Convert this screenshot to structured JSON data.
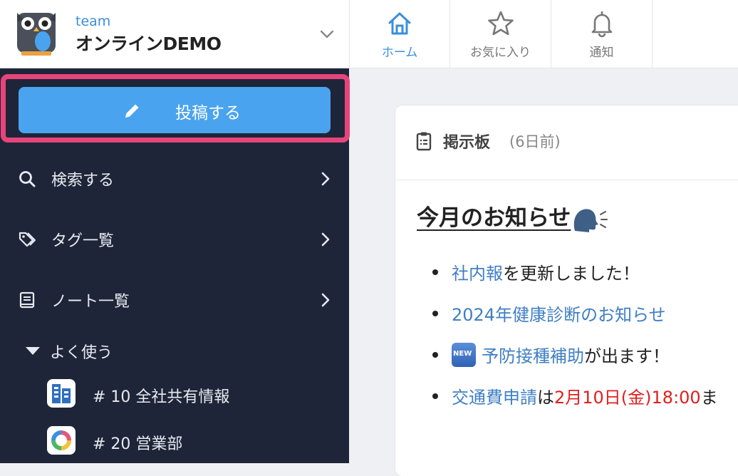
{
  "team": {
    "label": "team",
    "name": "オンラインDEMO"
  },
  "top_nav": {
    "tabs": [
      {
        "label": "ホーム",
        "icon": "home-icon",
        "active": true
      },
      {
        "label": "お気に入り",
        "icon": "star-icon",
        "active": false
      },
      {
        "label": "通知",
        "icon": "bell-icon",
        "active": false
      }
    ]
  },
  "sidebar": {
    "post_button_label": "投稿する",
    "items": [
      {
        "label": "検索する",
        "icon": "search-icon",
        "highlighted": true
      },
      {
        "label": "タグ一覧",
        "icon": "tag-icon",
        "highlighted": false
      },
      {
        "label": "ノート一覧",
        "icon": "notebook-icon",
        "highlighted": false
      }
    ],
    "section_label": "よく使う",
    "channels": [
      {
        "label": "# 10 全社共有情報",
        "icon": "building-icon"
      },
      {
        "label": "# 20 営業部",
        "icon": "ring-chart-icon"
      }
    ]
  },
  "post": {
    "board_label": "掲示板",
    "time_ago": "(6日前)",
    "title": "今月のお知らせ",
    "bullets": [
      {
        "link": "社内報",
        "rest": "を更新しました！"
      },
      {
        "link": "2024年健康診断のお知らせ",
        "rest": ""
      },
      {
        "badge": "NEW",
        "link": "予防接種補助",
        "rest": "が出ます！"
      },
      {
        "link": "交通費申請",
        "mid": "は",
        "red": "2月10日(金)18:00",
        "rest": "ま"
      }
    ]
  },
  "colors": {
    "accent": "#3b8fd9",
    "sidebar_bg": "#1e2538",
    "post_button": "#4aa3ee",
    "highlight_border": "#e5457a",
    "link": "#3f7fc3",
    "deadline_red": "#e02020"
  }
}
